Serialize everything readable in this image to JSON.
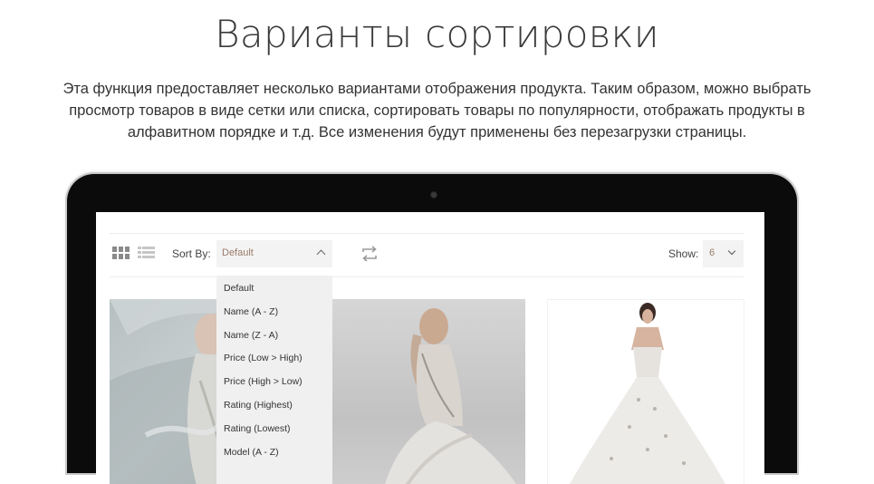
{
  "heading": "Варианты сортировки",
  "description": "Эта функция предоставляет несколько вариантами отображения продукта. Таким образом, можно выбрать просмотр товаров в виде сетки или списка, сортировать товары по популярности, отображать продукты в алфавитном порядке и т.д. Все изменения будут применены без перезагрузки страницы.",
  "toolbar": {
    "view_icons": [
      "grid-view-icon",
      "list-view-icon"
    ],
    "sort_label": "Sort By:",
    "sort_value": "Default",
    "compare_icon": "repeat-icon",
    "show_label": "Show:",
    "show_value": "6"
  },
  "sort_options": [
    "Default",
    "Name (A - Z)",
    "Name (Z - A)",
    "Price (Low > High)",
    "Price (High > Low)",
    "Rating (Highest)",
    "Rating (Lowest)",
    "Model (A - Z)"
  ],
  "products": [
    {
      "image": "bride-veil-photo"
    },
    {
      "image": "bride-gown-back-photo"
    },
    {
      "image": "ball-gown-photo"
    }
  ],
  "colors": {
    "accent_text": "#9b7d6a",
    "laptop_frame": "#0b0b0b",
    "select_bg": "#f3f3f3"
  }
}
